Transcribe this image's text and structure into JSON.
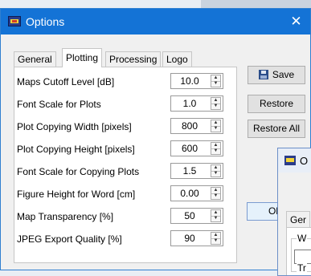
{
  "window": {
    "title": "Options",
    "close_symbol": "✕"
  },
  "tabs": [
    "General",
    "Plotting",
    "Processing",
    "Logo"
  ],
  "active_tab": "Plotting",
  "settings": [
    {
      "label": "Maps Cutoff Level [dB]",
      "value": "10.0"
    },
    {
      "label": "Font Scale for Plots",
      "value": "1.0"
    },
    {
      "label": "Plot Copying Width [pixels]",
      "value": "800"
    },
    {
      "label": "Plot Copying Height [pixels]",
      "value": "600"
    },
    {
      "label": "Font Scale for Copying Plots",
      "value": "1.5"
    },
    {
      "label": "Figure Height for Word [cm]",
      "value": "0.00"
    },
    {
      "label": "Map Transparency [%]",
      "value": "50"
    },
    {
      "label": "JPEG Export Quality [%]",
      "value": "90"
    }
  ],
  "buttons": {
    "save": "Save",
    "restore": "Restore",
    "restore_all": "Restore All",
    "ok_partial": "Ok"
  },
  "child_window": {
    "title_partial": "O",
    "tab_partial": "Ger",
    "group1_partial": "W",
    "group2_partial": "Tr"
  },
  "colors": {
    "titlebar": "#1473d6",
    "accent": "#0078d7"
  }
}
